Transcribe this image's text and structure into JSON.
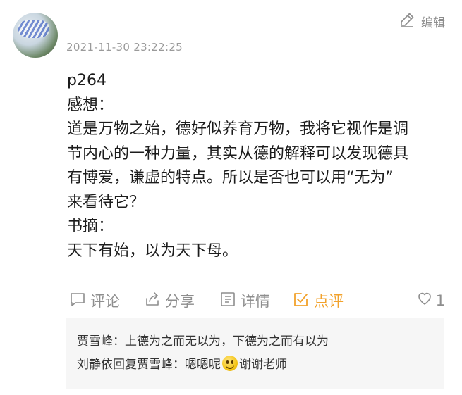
{
  "header": {
    "timestamp": "2021-11-30 23:22:25",
    "edit_label": "编辑",
    "edit_icon": "pencil-icon"
  },
  "post": {
    "lines": [
      "p264",
      "感想：",
      "道是万物之始，德好似养育万物，我将它视作是调",
      "节内心的一种力量，其实从德的解释可以发现德具",
      "有博爱，谦虚的特点。所以是否也可以用“无为”",
      "来看待它？",
      "书摘：",
      "天下有始，以为天下母。"
    ]
  },
  "actions": {
    "comment_label": "评论",
    "share_label": "分享",
    "detail_label": "详情",
    "review_label": "点评",
    "like_count": "1",
    "accent_color": "#f2a22c",
    "muted_color": "#8e8e8e"
  },
  "comments": {
    "items": [
      {
        "author": "贾雪峰",
        "separator": "：",
        "text": "上德为之而无以为，下德为之而有以为"
      },
      {
        "author": "刘静依",
        "reply_word": "回复",
        "reply_to": "贾雪峰",
        "separator": "：",
        "text_before_emoji": "嗯嗯呢",
        "emoji": "smiling-face-emoji",
        "text_after_emoji": "谢谢老师"
      }
    ]
  }
}
